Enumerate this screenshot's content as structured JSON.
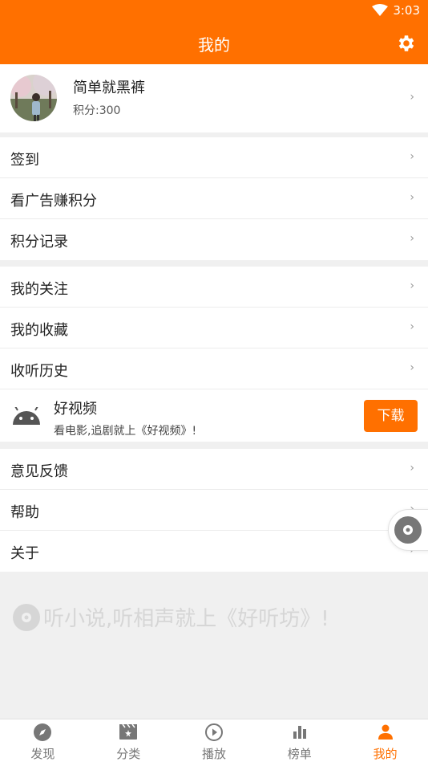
{
  "status": {
    "time": "3:03"
  },
  "header": {
    "title": "我的"
  },
  "profile": {
    "name": "简单就黑裤",
    "points": "积分:300"
  },
  "group1": [
    "签到",
    "看广告赚积分",
    "积分记录"
  ],
  "group2": [
    "我的关注",
    "我的收藏",
    "收听历史"
  ],
  "ad": {
    "title": "好视频",
    "subtitle": "看电影,追剧就上《好视频》!",
    "button": "下载"
  },
  "group3": [
    "意见反馈",
    "帮助",
    "关于"
  ],
  "footer_note": "听小说,听相声就上《好听坊》!",
  "nav": {
    "discover": "发现",
    "category": "分类",
    "play": "播放",
    "ranking": "榜单",
    "mine": "我的"
  },
  "colors": {
    "accent": "#ff7000"
  }
}
